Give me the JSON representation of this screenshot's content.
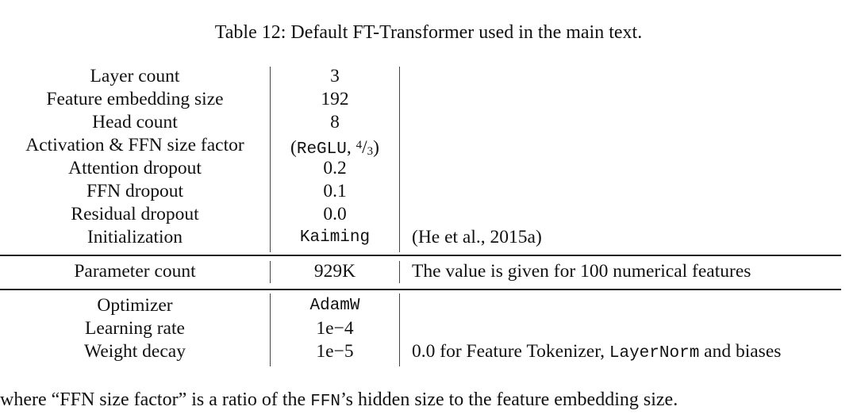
{
  "caption": "Table 12: Default FT-Transformer used in the main text.",
  "sections": [
    {
      "rows": [
        {
          "param": "Layer count",
          "value": "3",
          "note": ""
        },
        {
          "param": "Feature embedding size",
          "value": "192",
          "note": ""
        },
        {
          "param": "Head count",
          "value": "8",
          "note": ""
        },
        {
          "param": "Activation & FFN size factor",
          "value_prefix": "(",
          "value_mono": "ReGLU",
          "value_sep": ", ",
          "frac_num": "4",
          "frac_den": "3",
          "value_suffix": ")",
          "note": ""
        },
        {
          "param": "Attention dropout",
          "value": "0.2",
          "note": ""
        },
        {
          "param": "FFN dropout",
          "value": "0.1",
          "note": ""
        },
        {
          "param": "Residual dropout",
          "value": "0.0",
          "note": ""
        },
        {
          "param": "Initialization",
          "value": "Kaiming",
          "note": "(He et al., 2015a)"
        }
      ]
    },
    {
      "rows": [
        {
          "param": "Parameter count",
          "value": "929K",
          "note": "The value is given for 100 numerical features"
        }
      ]
    },
    {
      "rows": [
        {
          "param": "Optimizer",
          "value": "AdamW",
          "note": ""
        },
        {
          "param": "Learning rate",
          "value": "1e−4",
          "note": ""
        },
        {
          "param": "Weight decay",
          "value": "1e−5",
          "note_prefix": "0.0 for Feature Tokenizer, ",
          "note_mono": "LayerNorm",
          "note_suffix": " and biases"
        }
      ]
    }
  ],
  "footnote": {
    "prefix": "where “FFN size factor” is a ratio of the ",
    "mono": "FFN",
    "suffix": "’s hidden size to the feature embedding size."
  }
}
